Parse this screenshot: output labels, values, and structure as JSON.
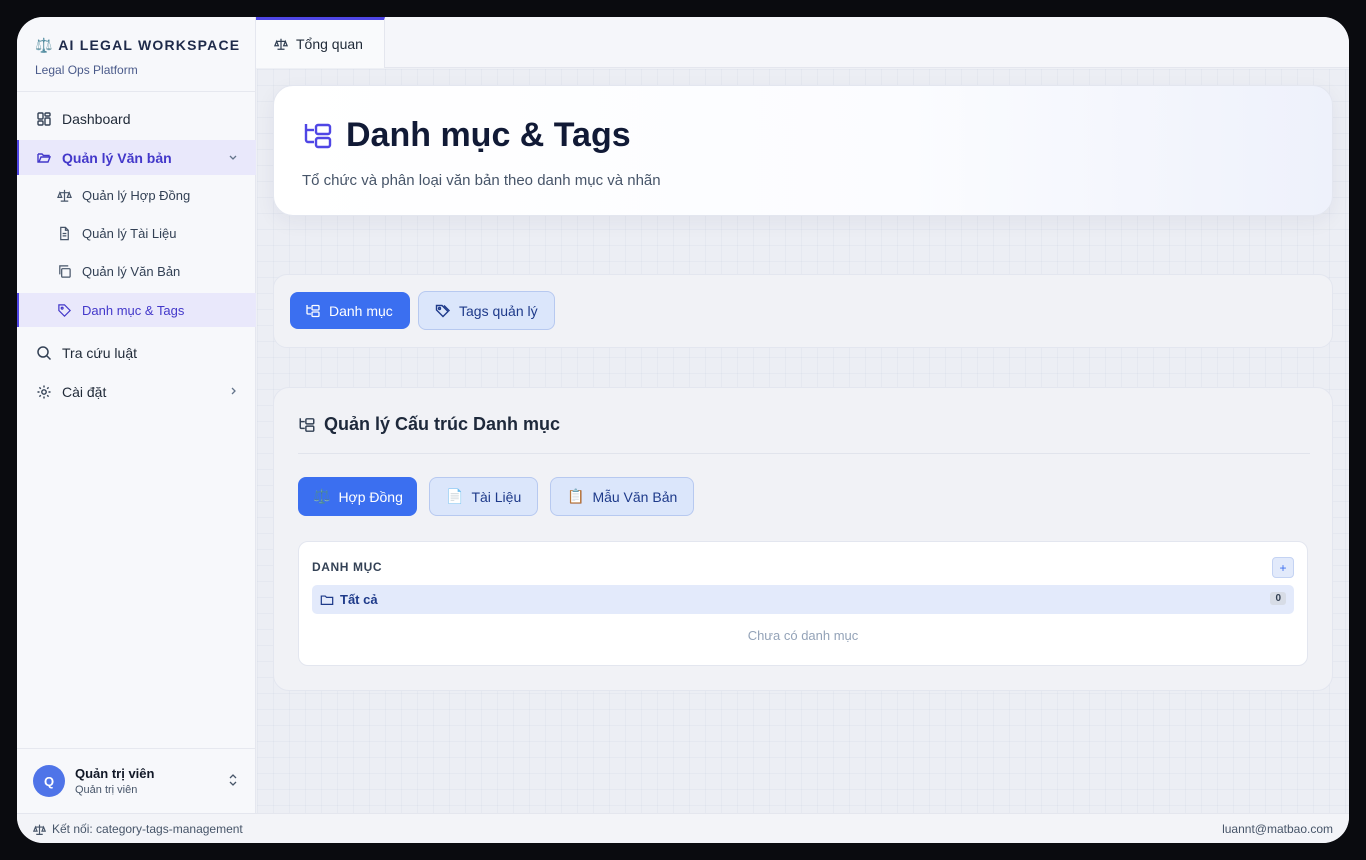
{
  "brand": {
    "title": "⚖️ AI LEGAL WORKSPACE",
    "subtitle": "Legal Ops Platform"
  },
  "sidebar": {
    "items": [
      {
        "label": "Dashboard",
        "icon": "dashboard-icon"
      },
      {
        "label": "Quản lý Văn bản",
        "icon": "folder-open-icon",
        "active": true,
        "expanded": true
      },
      {
        "label": "Tra cứu luật",
        "icon": "search-icon"
      },
      {
        "label": "Cài đặt",
        "icon": "gear-icon"
      }
    ],
    "subitems": [
      {
        "label": "Quản lý Hợp Đồng",
        "icon": "scale-icon"
      },
      {
        "label": "Quản lý Tài Liệu",
        "icon": "file-text-icon"
      },
      {
        "label": "Quản lý Văn Bản",
        "icon": "copy-icon"
      },
      {
        "label": "Danh mục & Tags",
        "icon": "tag-icon",
        "active": true
      }
    ]
  },
  "user": {
    "initial": "Q",
    "name": "Quản trị viên",
    "role": "Quản trị viên"
  },
  "tabs": [
    {
      "label": "Tổng quan",
      "icon": "scale-icon"
    }
  ],
  "hero": {
    "title": "Danh mục & Tags",
    "subtitle": "Tổ chức và phân loại văn bản theo danh mục và nhãn"
  },
  "segment": {
    "categories_label": "Danh mục",
    "tags_label": "Tags quản lý"
  },
  "panel": {
    "title": "Quản lý Cấu trúc Danh mục",
    "types": [
      {
        "emoji": "⚖️",
        "label": "Hợp Đồng",
        "active": true
      },
      {
        "emoji": "📄",
        "label": "Tài Liệu"
      },
      {
        "emoji": "📋",
        "label": "Mẫu Văn Bản"
      }
    ],
    "box_header": "DANH MỤC",
    "add_symbol": "+",
    "all_label": "Tất cả",
    "all_count": "0",
    "empty_text": "Chưa có danh mục"
  },
  "footer": {
    "connection": "Kết nối: category-tags-management",
    "email": "luannt@matbao.com"
  },
  "colors": {
    "accent": "#4f46e5",
    "primary": "#3b6ff0",
    "soft": "#dbe6fb"
  }
}
